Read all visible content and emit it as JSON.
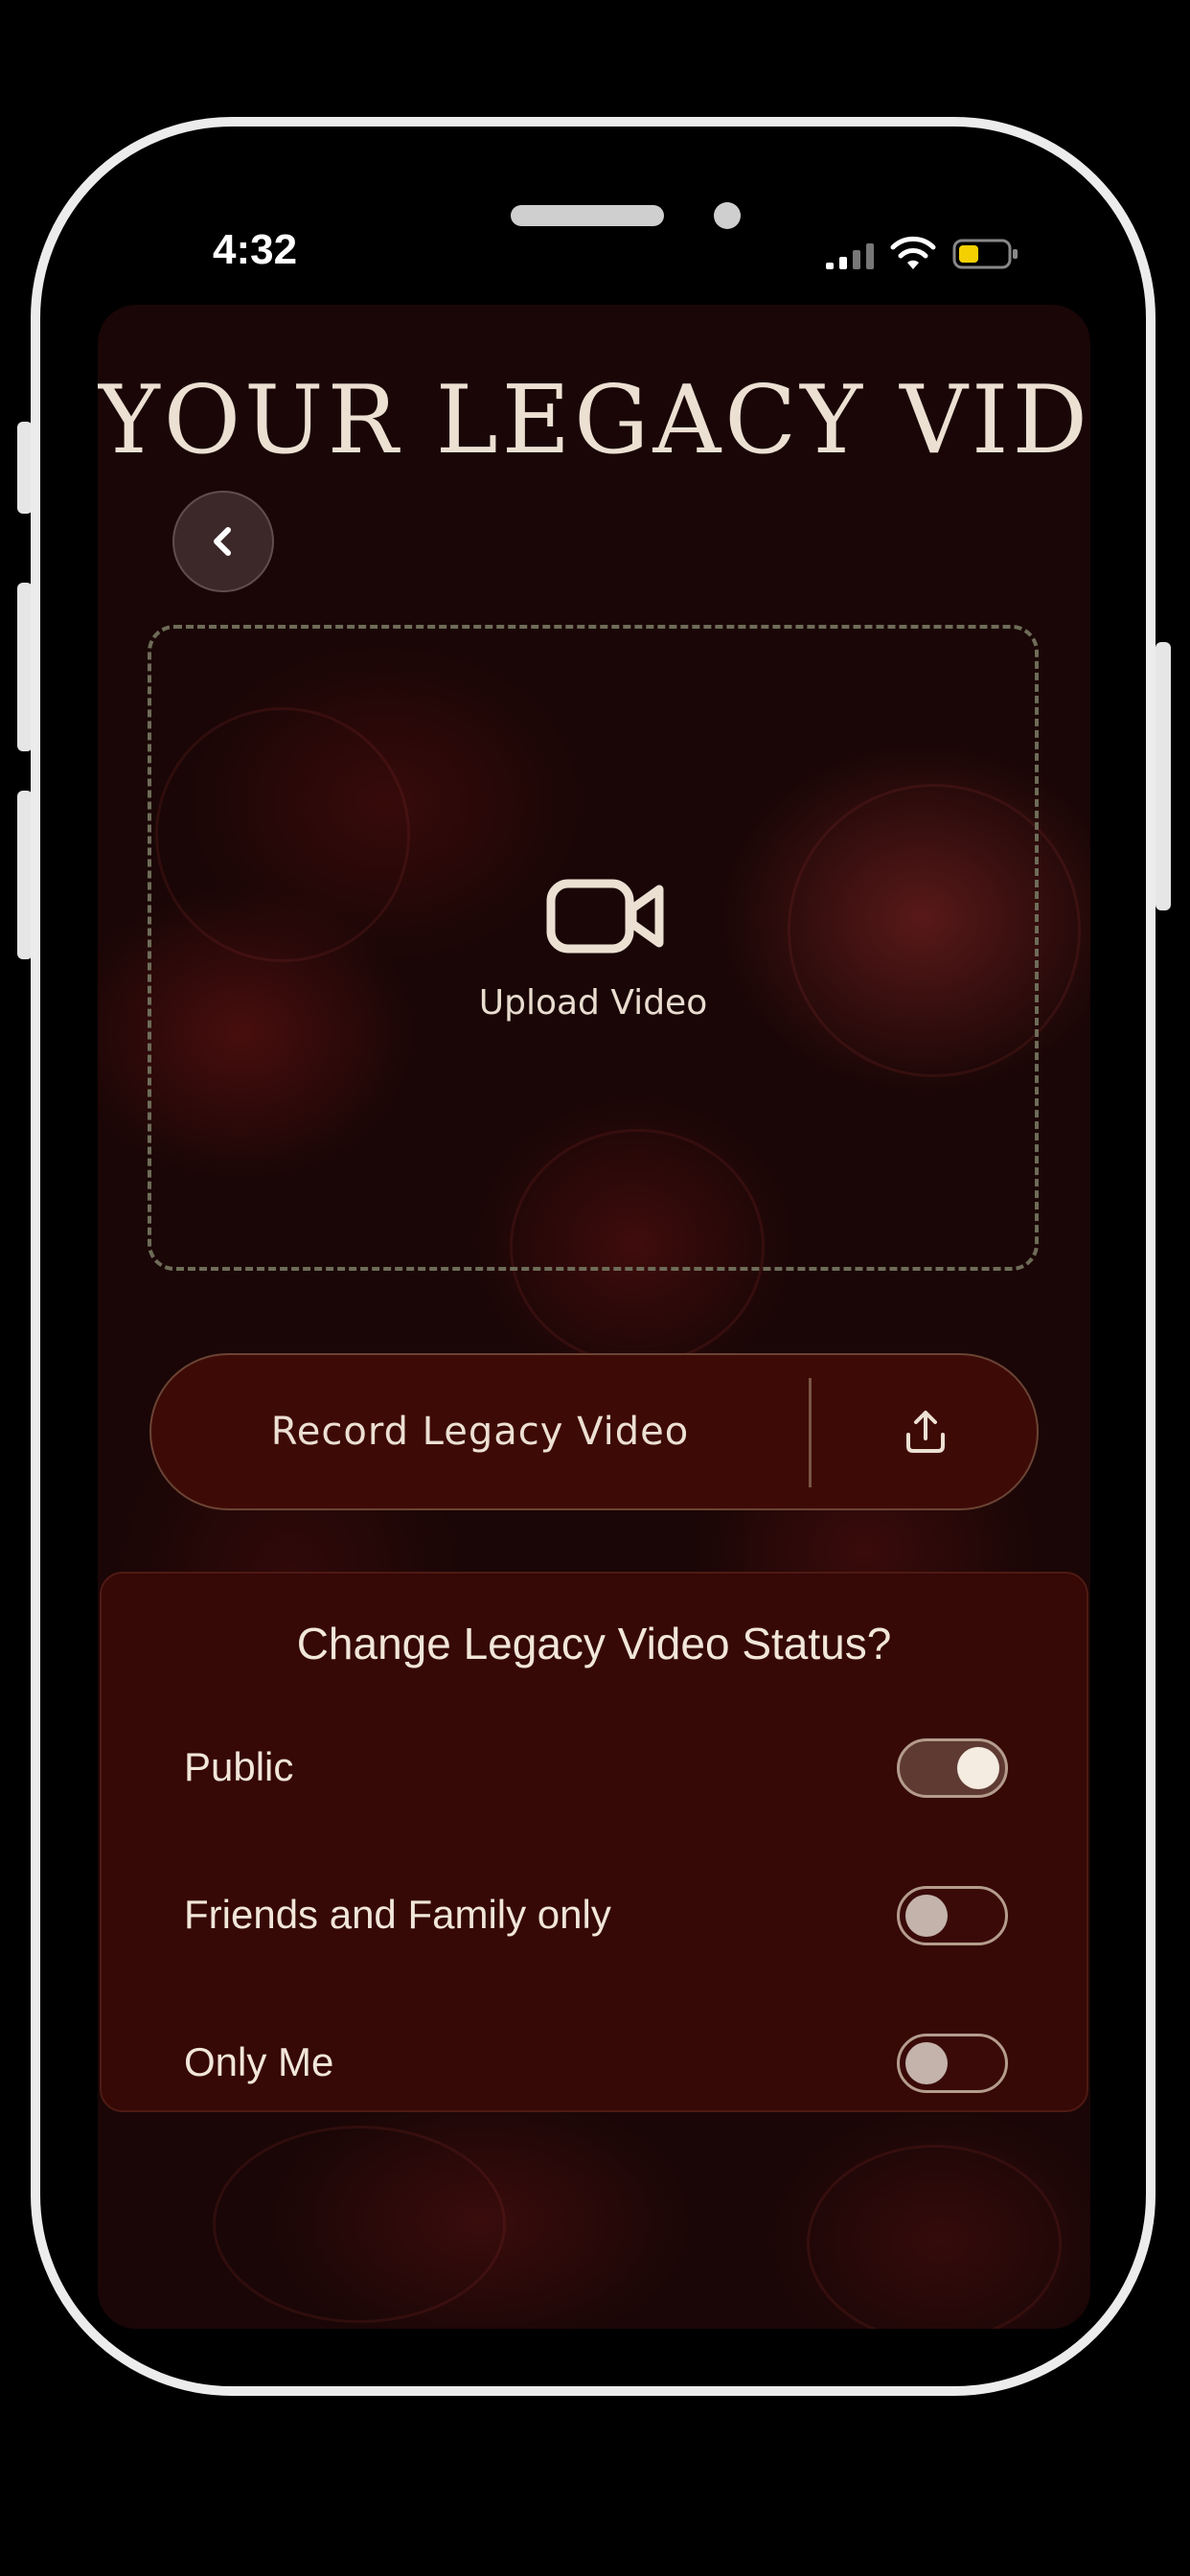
{
  "status_bar": {
    "time": "4:32"
  },
  "screen": {
    "title": "YOUR LEGACY VIDEO",
    "back_icon": "chevron-left-icon",
    "upload": {
      "icon": "video-camera-icon",
      "label": "Upload Video"
    },
    "record_bar": {
      "record_label": "Record Legacy Video",
      "share_icon": "upload-share-icon"
    },
    "status_panel": {
      "title": "Change Legacy Video Status?",
      "options": [
        {
          "label": "Public",
          "enabled": true
        },
        {
          "label": "Friends and Family only",
          "enabled": false
        },
        {
          "label": "Only Me",
          "enabled": false
        }
      ]
    }
  },
  "colors": {
    "background": "#000000",
    "panel": "#360806",
    "record_bar": "#3e0a06",
    "text": "#ece0d3",
    "dashed_border": "#6e6c58"
  }
}
